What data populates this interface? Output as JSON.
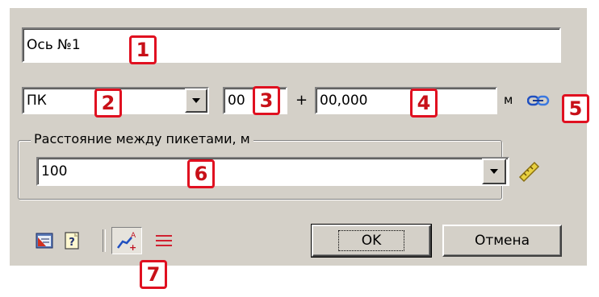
{
  "name_field": {
    "value": "Ось №1"
  },
  "picket_prefix_select": {
    "value": "ПК"
  },
  "picket_number": {
    "value": "00"
  },
  "plus_sign": "+",
  "offset_field": {
    "value": "00,000"
  },
  "unit": "м",
  "spacing_group": {
    "legend": "Расстояние между пикетами, м",
    "value": "100"
  },
  "buttons": {
    "ok": "OK",
    "cancel": "Отмена"
  },
  "badges": [
    "1",
    "2",
    "3",
    "4",
    "5",
    "6",
    "7"
  ],
  "icons": {
    "link": "link-chain-icon",
    "ruler": "ruler-measure-icon",
    "table": "table-settings-icon",
    "help": "help-question-icon",
    "axis_annotate": "axis-annotate-icon",
    "parallel_lines": "parallel-lines-icon"
  },
  "colors": {
    "badge": "#e01020",
    "dialog": "#d4d0c8"
  }
}
